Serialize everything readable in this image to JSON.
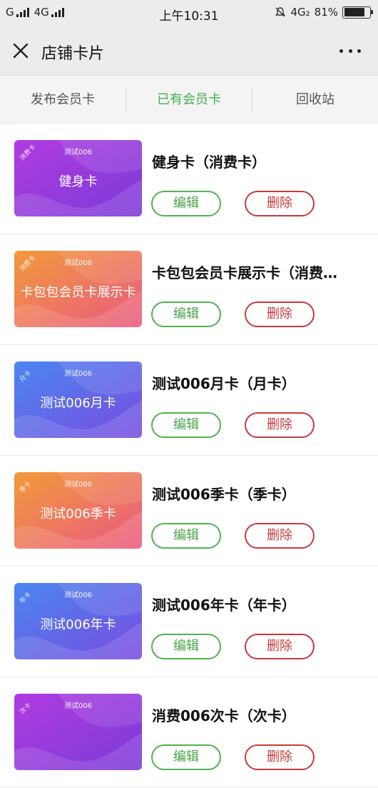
{
  "status_bar": {
    "carrier1": "G",
    "carrier2": "4G",
    "time": "上午10:31",
    "network": "4G₂",
    "battery": "81%",
    "battery_level": 0.81
  },
  "header": {
    "title": "店铺卡片",
    "close_icon": "close-icon",
    "more_icon": "more-icon"
  },
  "tabs": [
    {
      "label": "发布会员卡"
    },
    {
      "label": "已有会员卡"
    },
    {
      "label": "回收站"
    }
  ],
  "cards": [
    {
      "thumb_badge": "消费卡",
      "thumb_small": "测试006",
      "thumb_name": "健身卡",
      "title": "健身卡（消费卡）",
      "edit_label": "编辑",
      "delete_label": "删除",
      "colors": [
        "#b03be0",
        "#7b3bd8"
      ]
    },
    {
      "thumb_badge": "消费卡",
      "thumb_small": "测试006",
      "thumb_name": "卡包包会员卡展示卡",
      "title": "卡包包会员卡展示卡（消费…",
      "edit_label": "编辑",
      "delete_label": "删除",
      "colors": [
        "#f29a3a",
        "#ea5a82"
      ]
    },
    {
      "thumb_badge": "月卡",
      "thumb_small": "测试006",
      "thumb_name": "测试006月卡",
      "title": "测试006月卡（月卡）",
      "edit_label": "编辑",
      "delete_label": "删除",
      "colors": [
        "#4a86f0",
        "#7a4ce0"
      ]
    },
    {
      "thumb_badge": "季卡",
      "thumb_small": "测试006",
      "thumb_name": "测试006季卡",
      "title": "测试006季卡（季卡）",
      "edit_label": "编辑",
      "delete_label": "删除",
      "colors": [
        "#f29a3a",
        "#ea5a82"
      ]
    },
    {
      "thumb_badge": "年卡",
      "thumb_small": "测试006",
      "thumb_name": "测试006年卡",
      "title": "测试006年卡（年卡）",
      "edit_label": "编辑",
      "delete_label": "删除",
      "colors": [
        "#4a86f0",
        "#7a4ce0"
      ]
    },
    {
      "thumb_badge": "次卡",
      "thumb_small": "测试006",
      "thumb_name": "",
      "title": "消费006次卡（次卡）",
      "edit_label": "编辑",
      "delete_label": "删除",
      "colors": [
        "#b03be0",
        "#7b3bd8"
      ]
    }
  ],
  "colors": {
    "accent_green": "#3fb14a",
    "delete_red": "#c83a3a"
  }
}
